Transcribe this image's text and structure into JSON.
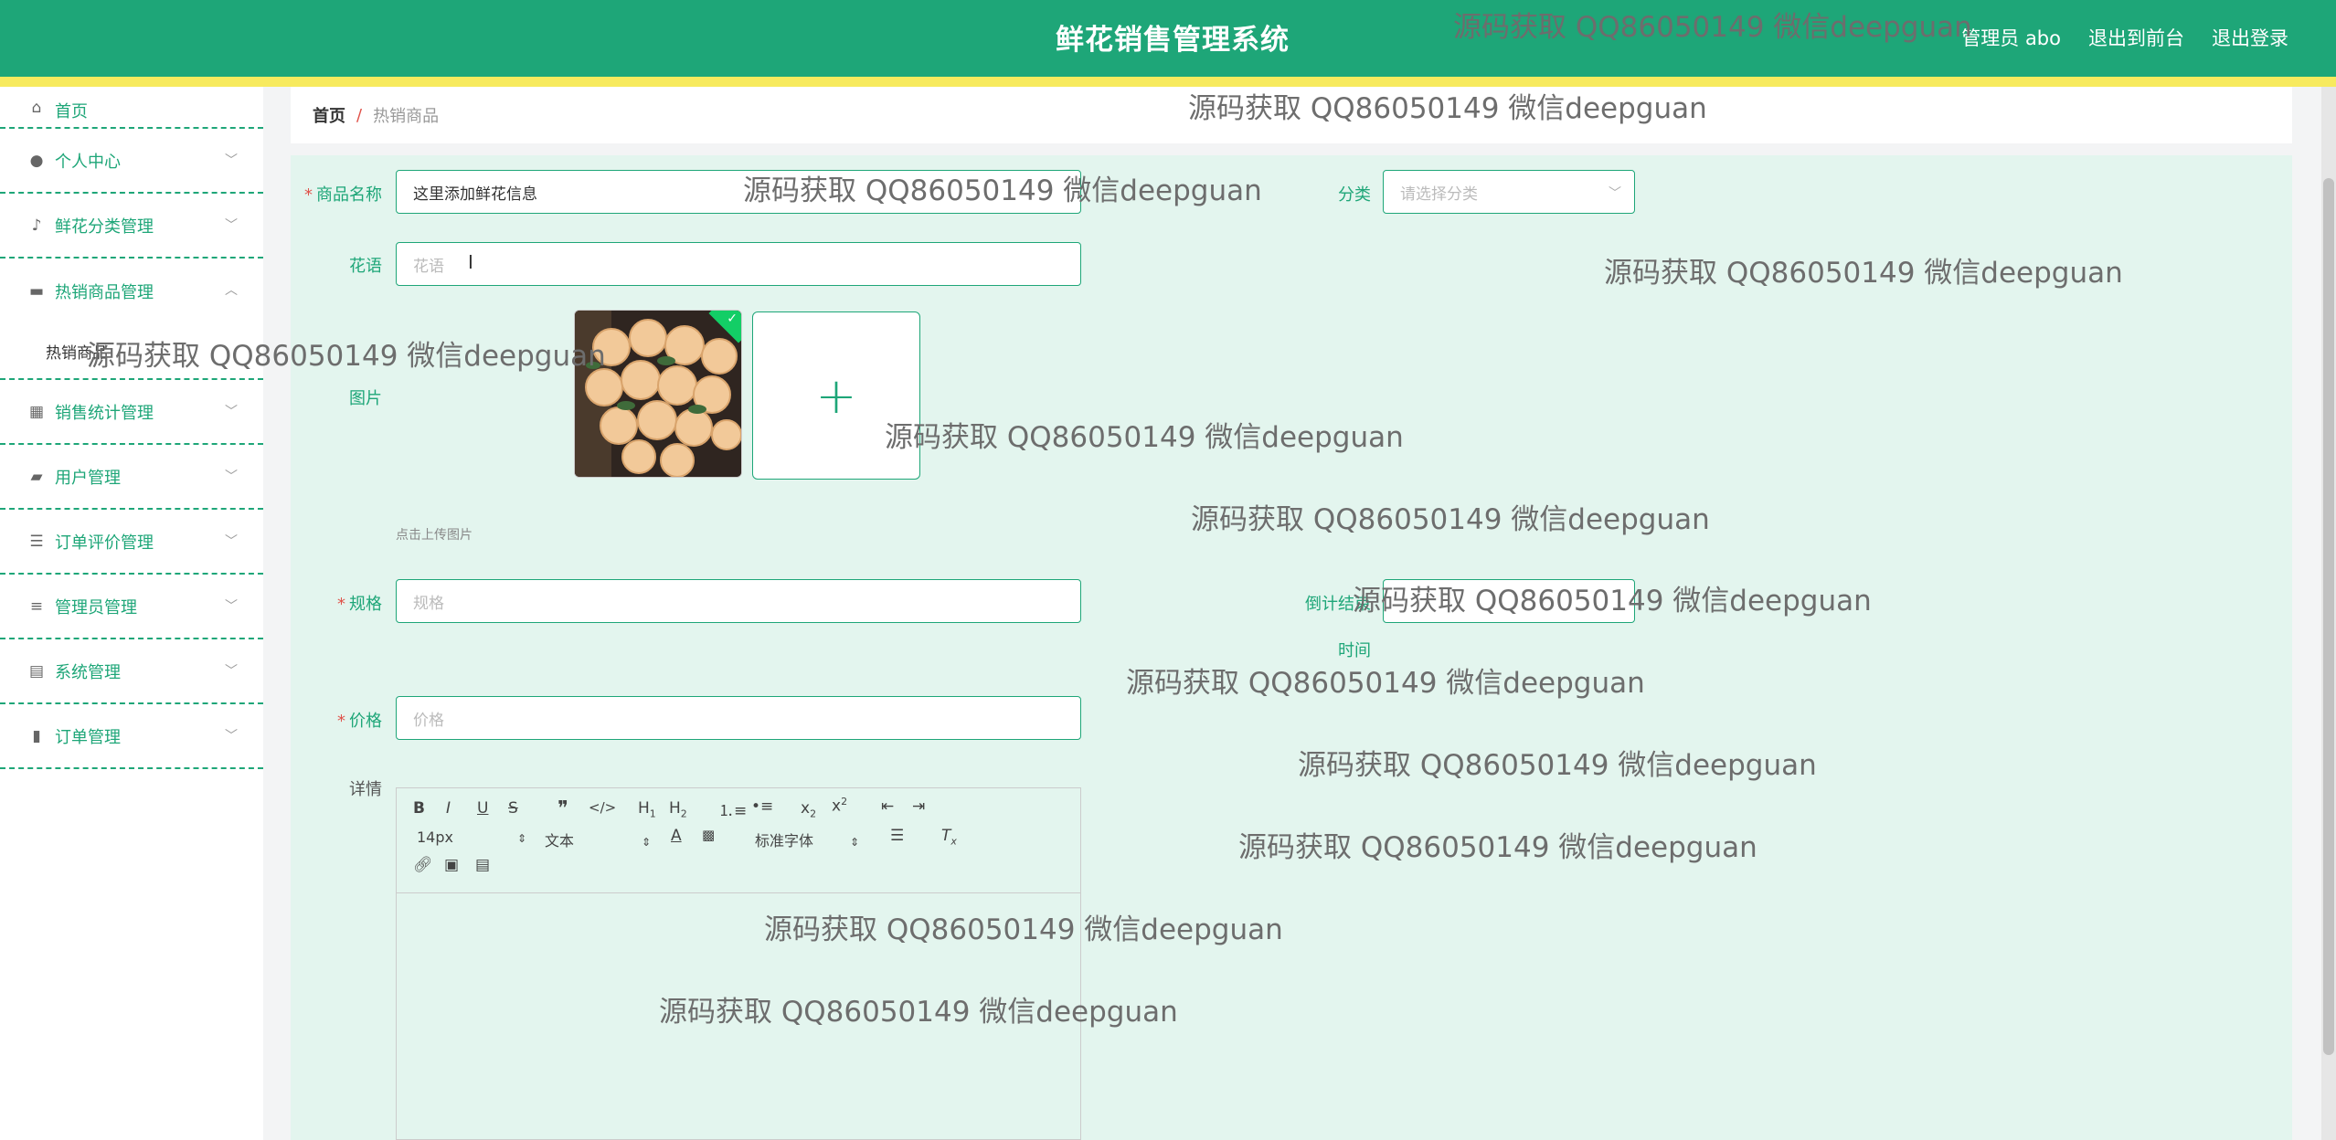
{
  "header": {
    "title": "鲜花销售管理系统",
    "links": [
      "管理员 abo",
      "退出到前台",
      "退出登录"
    ]
  },
  "sidebar": {
    "items": [
      {
        "label": "首页",
        "icon": "home-icon"
      },
      {
        "label": "个人中心",
        "icon": "user-icon"
      },
      {
        "label": "鲜花分类管理",
        "icon": "mic-icon"
      },
      {
        "label": "热销商品管理",
        "icon": "book-icon",
        "expanded": true
      },
      {
        "label": "销售统计管理",
        "icon": "grid-icon"
      },
      {
        "label": "用户管理",
        "icon": "wallet-icon"
      },
      {
        "label": "订单评价管理",
        "icon": "list-icon"
      },
      {
        "label": "管理员管理",
        "icon": "sliders-icon"
      },
      {
        "label": "系统管理",
        "icon": "clipboard-icon"
      },
      {
        "label": "订单管理",
        "icon": "chart-icon"
      }
    ],
    "submenu_label": "热销商品"
  },
  "breadcrumb": {
    "home": "首页",
    "separator": "/",
    "current": "热销商品"
  },
  "form": {
    "name_label": "商品名称",
    "name_value": "这里添加鲜花信息",
    "category_label": "分类",
    "category_placeholder": "请选择分类",
    "flower_lang_label": "花语",
    "flower_lang_placeholder": "花语",
    "image_label": "图片",
    "upload_tip": "点击上传图片",
    "spec_label": "规格",
    "spec_placeholder": "规格",
    "countdown_label_1": "倒计结束",
    "countdown_label_2": "时间",
    "price_label": "价格",
    "price_placeholder": "价格",
    "detail_label": "详情"
  },
  "editor": {
    "font_size": "14px",
    "text_style": "文本",
    "font_family": "标准字体"
  },
  "watermark_text": "源码获取 QQ86050149 微信deepguan",
  "colors": {
    "primary": "#1ea678",
    "stripe": "#f7ea5e",
    "required": "#e0524a"
  }
}
